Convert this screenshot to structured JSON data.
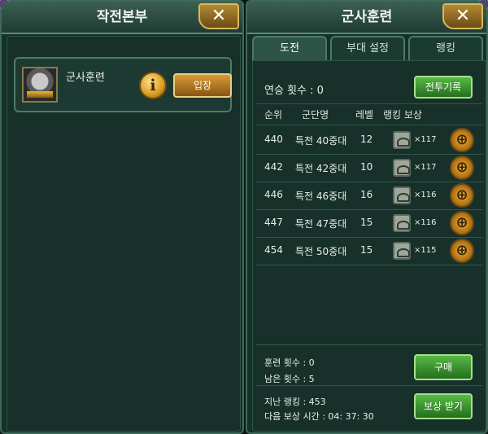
{
  "left_window": {
    "title": "작전본부",
    "close_label": "✕",
    "mission": {
      "name": "군사훈련",
      "info_label": "i",
      "enter_label": "입장"
    }
  },
  "right_window": {
    "title": "군사훈련",
    "close_label": "✕",
    "tabs": [
      {
        "label": "도전",
        "active": true
      },
      {
        "label": "부대 설정",
        "active": false
      },
      {
        "label": "랭킹",
        "active": false
      }
    ],
    "streak_text": "연승 횟수 : 0",
    "battle_log_label": "전투기록",
    "table": {
      "headers": [
        "순위",
        "군단명",
        "레벨",
        "랭킹 보상"
      ],
      "rows": [
        {
          "rank": "440",
          "name": "특전 40중대",
          "level": "12",
          "reward": "×117"
        },
        {
          "rank": "442",
          "name": "특전 42중대",
          "level": "10",
          "reward": "×117"
        },
        {
          "rank": "446",
          "name": "특전 46중대",
          "level": "16",
          "reward": "×116"
        },
        {
          "rank": "447",
          "name": "특전 47중대",
          "level": "15",
          "reward": "×116"
        },
        {
          "rank": "454",
          "name": "특전 50중대",
          "level": "15",
          "reward": "×115"
        }
      ]
    },
    "training_count_text": "훈련 횟수 : 0",
    "remaining_count_text": "남은 횟수 : 5",
    "buy_label": "구매",
    "last_ranking_text": "지난 랭킹 : 453",
    "next_reward_time_text": "다음 보상 시간 : 04: 37: 30",
    "claim_reward_label": "보상 받기"
  },
  "icons": {
    "close": "close-icon",
    "info": "info-icon",
    "reward": "reward-item-icon",
    "target": "crosshair-icon"
  }
}
